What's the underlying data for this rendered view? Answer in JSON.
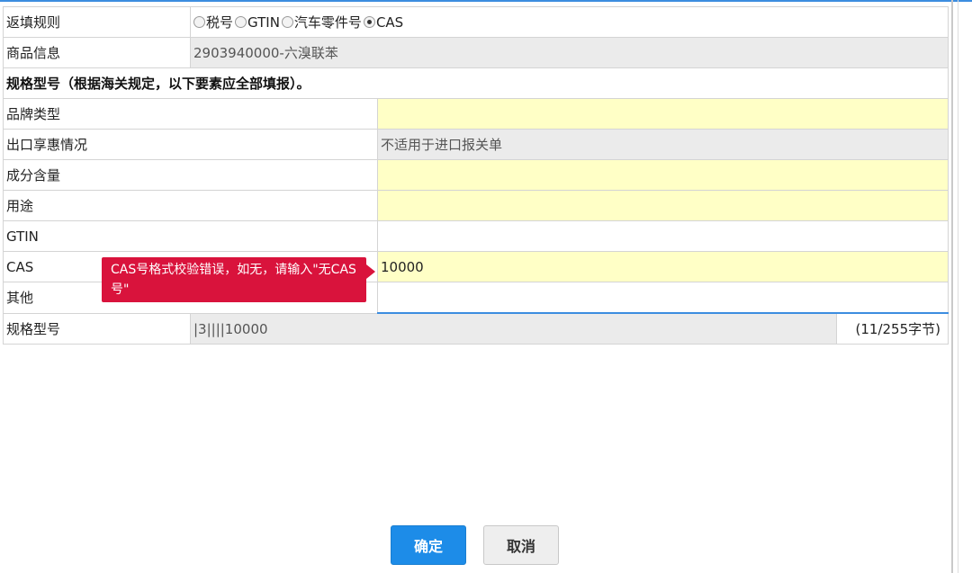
{
  "form": {
    "fill_rule": {
      "label": "返填规则",
      "options": [
        "税号",
        "GTIN",
        "汽车零件号",
        "CAS"
      ],
      "selected": "CAS"
    },
    "product_info": {
      "label": "商品信息",
      "value": "2903940000-六溴联苯"
    },
    "spec_heading": "规格型号（根据海关规定，以下要素应全部填报）。",
    "fields": [
      {
        "label": "品牌类型",
        "value": ""
      },
      {
        "label": "出口享惠情况",
        "value": "不适用于进口报关单"
      },
      {
        "label": "成分含量",
        "value": ""
      },
      {
        "label": "用途",
        "value": ""
      },
      {
        "label": "GTIN",
        "value": ""
      },
      {
        "label": "CAS",
        "value": "10000"
      },
      {
        "label": "其他",
        "value": ""
      }
    ],
    "spec_model": {
      "label": "规格型号",
      "value": "|3||||10000",
      "byte_count": "(11/255字节)"
    }
  },
  "tooltip": {
    "text": "CAS号格式校验错误，如无，请输入\"无CAS号\""
  },
  "buttons": {
    "ok_label": "确定",
    "cancel_label": "取消"
  },
  "colors": {
    "accent": "#1d8ce8",
    "error": "#d9133c",
    "required_field": "#ffffc6",
    "readonly_field": "#ebebeb"
  }
}
